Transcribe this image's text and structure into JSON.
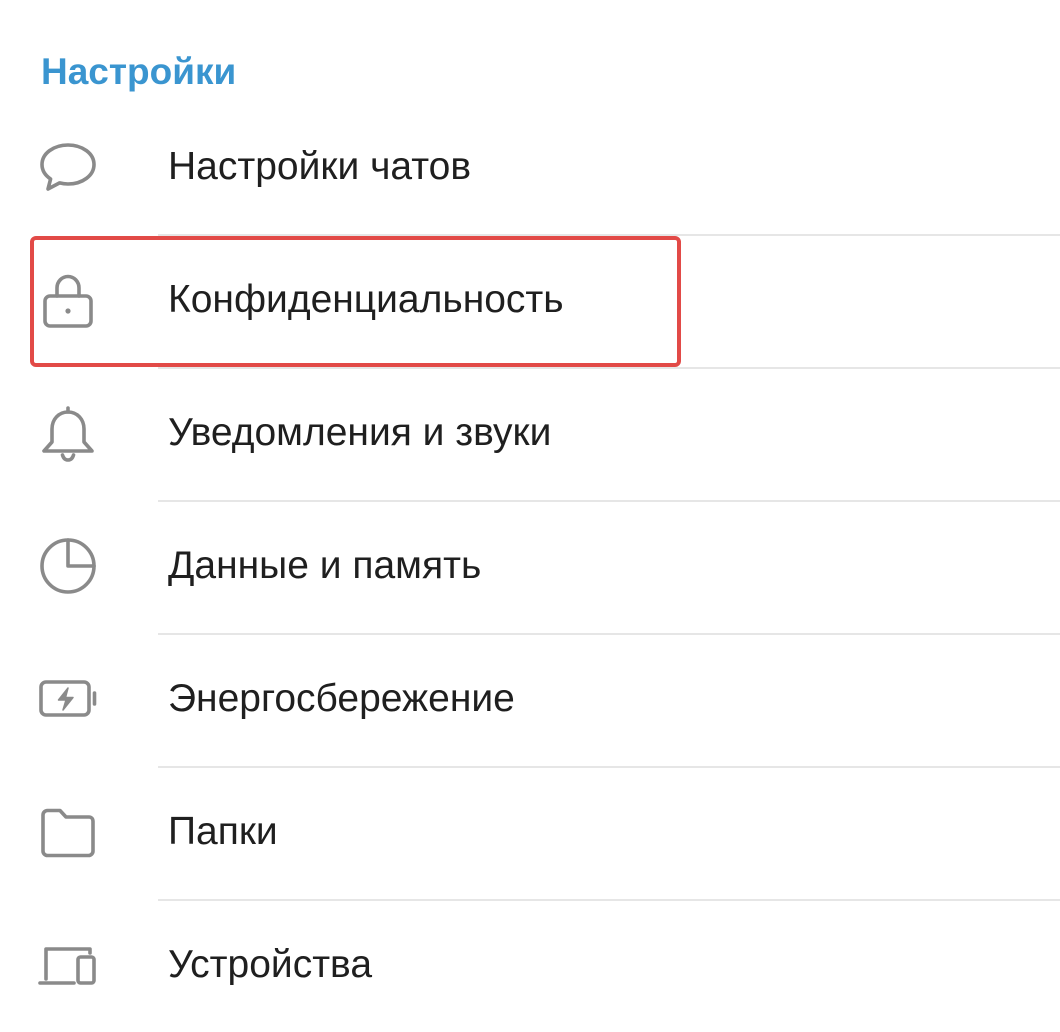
{
  "section": {
    "title": "Настройки"
  },
  "items": [
    {
      "label": "Настройки чатов",
      "icon": "chat-bubble-icon"
    },
    {
      "label": "Конфиденциальность",
      "icon": "lock-icon"
    },
    {
      "label": "Уведомления и звуки",
      "icon": "bell-icon"
    },
    {
      "label": "Данные и память",
      "icon": "pie-chart-icon"
    },
    {
      "label": "Энергосбережение",
      "icon": "battery-bolt-icon"
    },
    {
      "label": "Папки",
      "icon": "folder-icon"
    },
    {
      "label": "Устройства",
      "icon": "devices-icon"
    }
  ],
  "colors": {
    "accent": "#3a95d0",
    "icon": "#8a8a8a",
    "text": "#1f1f1f",
    "divider": "#e6e6e6",
    "highlight": "#e24a47"
  }
}
